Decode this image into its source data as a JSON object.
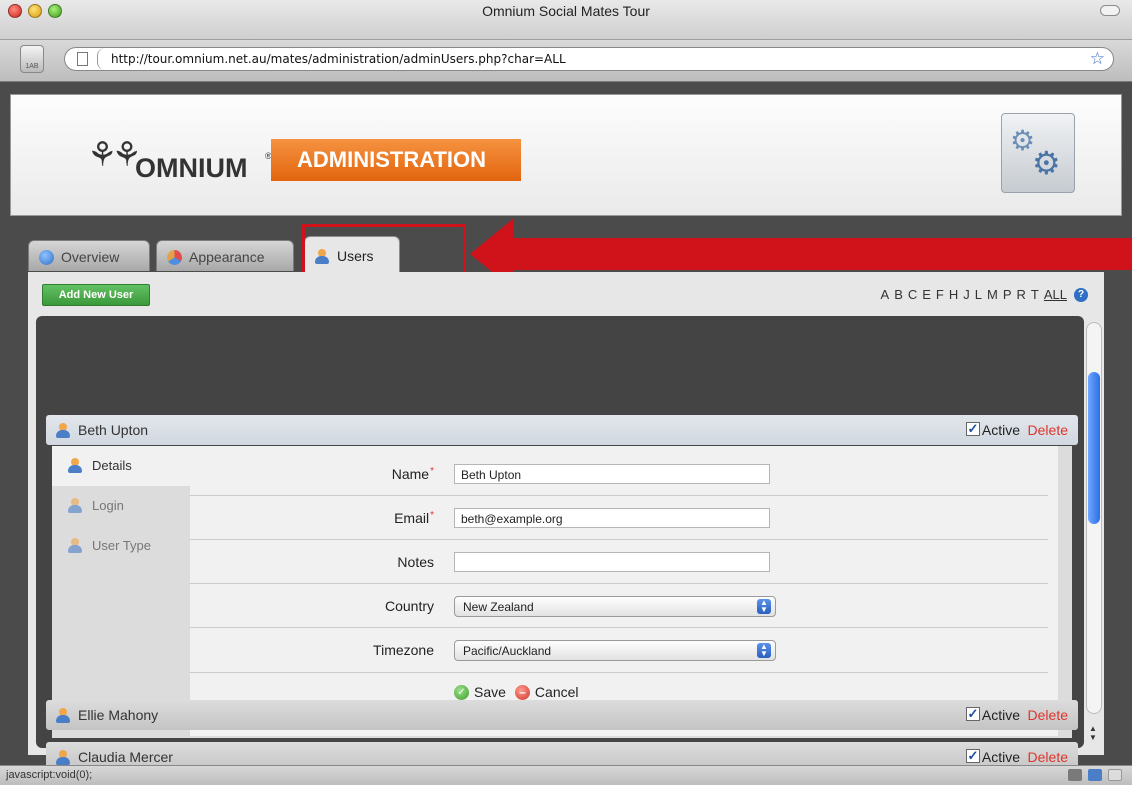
{
  "window": {
    "title": "Omnium Social Mates Tour"
  },
  "browser": {
    "url": "http://tour.omnium.net.au/mates/administration/adminUsers.php?char=ALL",
    "home_label": "1AB"
  },
  "banner": {
    "logo_text": "OMNIUM",
    "logo_reg": "®",
    "section_title": "ADMINISTRATION"
  },
  "tabs": [
    {
      "label": "Overview"
    },
    {
      "label": "Appearance"
    },
    {
      "label": "Users"
    }
  ],
  "toolbar": {
    "add_user_label": "Add New User",
    "letters": [
      "A",
      "B",
      "C",
      "E",
      "F",
      "H",
      "J",
      "L",
      "M",
      "P",
      "R",
      "T"
    ],
    "all_label": "ALL",
    "help_label": "?"
  },
  "users": [
    {
      "name": "Beth Upton",
      "active_label": "Active",
      "delete_label": "Delete"
    },
    {
      "name": "Claudia Mercer",
      "active_label": "Active",
      "delete_label": "Delete"
    },
    {
      "name": "Ellie Mahony",
      "active_label": "Active",
      "delete_label": "Delete"
    }
  ],
  "detail": {
    "side_tabs": [
      {
        "label": "Details"
      },
      {
        "label": "Login"
      },
      {
        "label": "User Type"
      }
    ],
    "fields": {
      "name": {
        "label": "Name",
        "value": "Beth Upton"
      },
      "email": {
        "label": "Email",
        "value": "beth@example.org"
      },
      "notes": {
        "label": "Notes",
        "value": ""
      },
      "country": {
        "label": "Country",
        "value": "New Zealand"
      },
      "timezone": {
        "label": "Timezone",
        "value": "Pacific/Auckland"
      }
    },
    "save_label": "Save",
    "cancel_label": "Cancel",
    "required_mark": "*"
  },
  "status": {
    "text": "javascript:void(0);"
  },
  "colors": {
    "accent_orange": "#e2650f",
    "highlight_red": "#d0121a",
    "delete_red": "#e0352c",
    "add_green": "#3a9a3a"
  }
}
